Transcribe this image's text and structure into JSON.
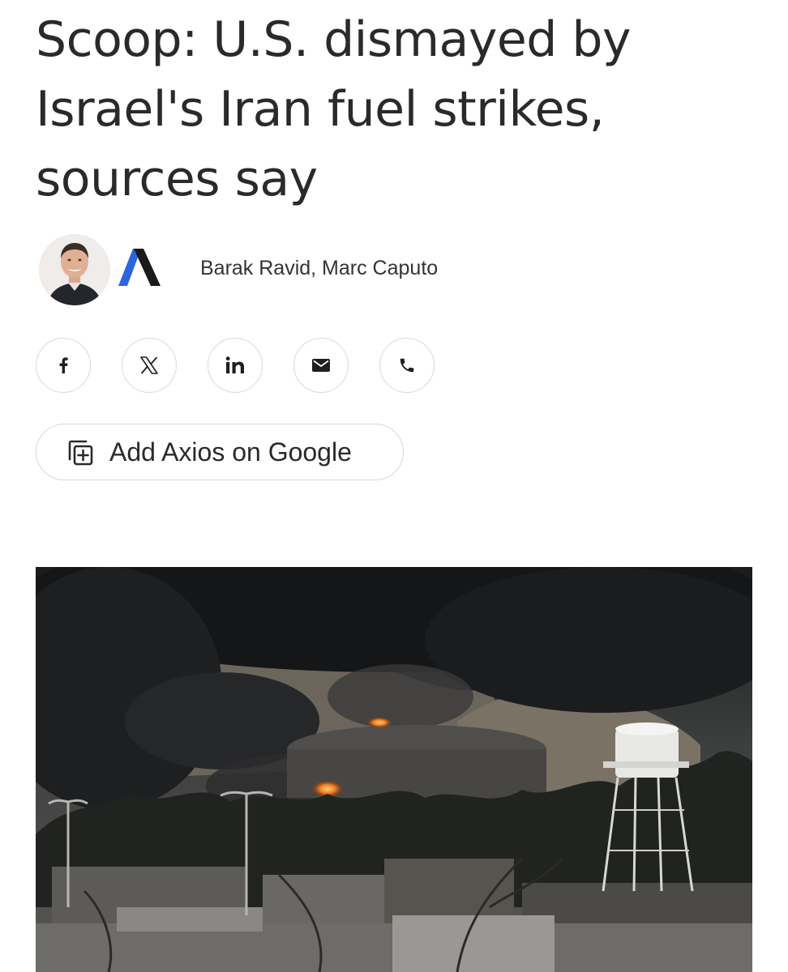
{
  "article": {
    "headline": "Scoop: U.S. dismayed by Israel's Iran fuel strikes, sources say",
    "authors": "Barak Ravid, Marc Caputo"
  },
  "byline": {
    "avatar_icon": "author-photo",
    "logo_icon": "axios-logo-icon",
    "logo_colors": {
      "left_stroke": "#2b66e0",
      "right_stroke": "#1a1a1a"
    }
  },
  "share": {
    "buttons": [
      {
        "icon": "facebook-icon"
      },
      {
        "icon": "x-icon"
      },
      {
        "icon": "linkedin-icon"
      },
      {
        "icon": "email-icon"
      },
      {
        "icon": "phone-icon"
      }
    ]
  },
  "google_button": {
    "label": "Add Axios on Google",
    "icon": "add-source-icon"
  },
  "hero_image": {
    "icon": "photo-fuel-depot-fire"
  },
  "colors": {
    "text": "#2a2a2a",
    "border": "#d8d8d8",
    "background": "#ffffff"
  }
}
